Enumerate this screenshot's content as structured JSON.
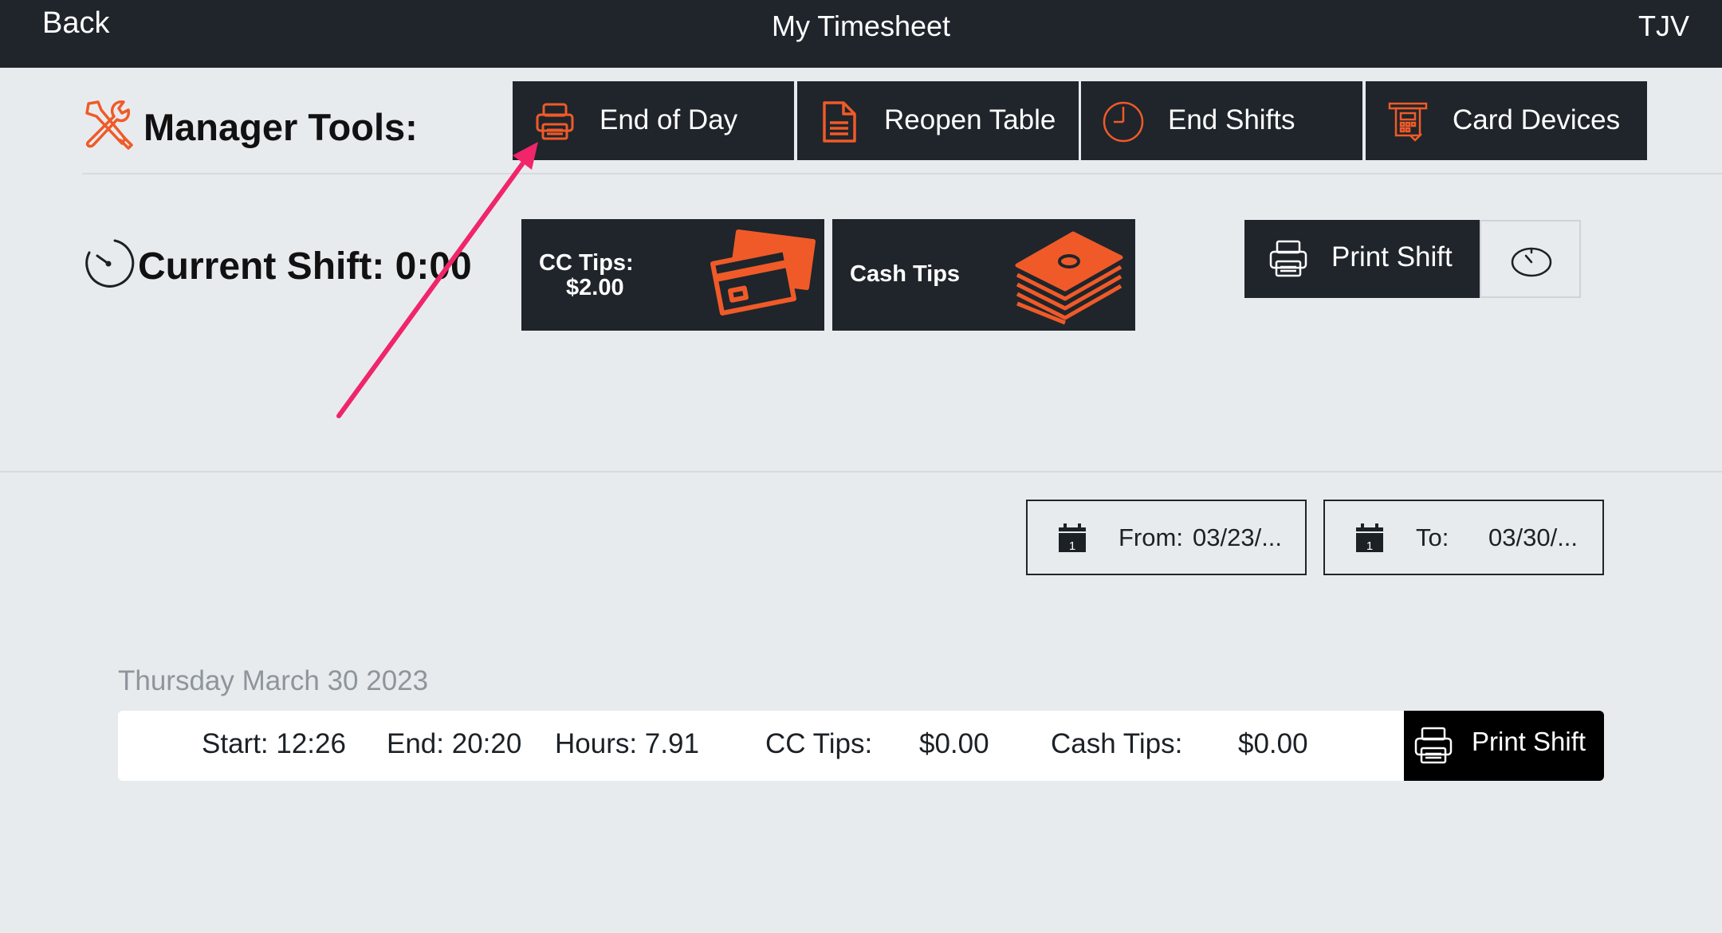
{
  "header": {
    "back_label": "Back",
    "title": "My Timesheet",
    "user_initials": "TJV"
  },
  "manager_tools": {
    "label": "Manager Tools:",
    "buttons": [
      {
        "label": "End of Day",
        "icon": "printer-icon"
      },
      {
        "label": "Reopen Table",
        "icon": "document-icon"
      },
      {
        "label": "End Shifts",
        "icon": "clock-icon"
      },
      {
        "label": "Card Devices",
        "icon": "card-terminal-icon"
      }
    ]
  },
  "current_shift": {
    "label": "Current Shift: 0:00",
    "cc_tips_label": "CC Tips:",
    "cc_tips_value": "$2.00",
    "cash_tips_label": "Cash Tips",
    "print_shift_label": "Print Shift"
  },
  "date_range": {
    "from_label": "From:",
    "from_value": "03/23/...",
    "to_label": "To:",
    "to_value": "03/30/...",
    "calendar_day": "1"
  },
  "shifts": [
    {
      "date": "Thursday March 30 2023",
      "start": "Start: 12:26",
      "end": "End: 20:20",
      "hours": "Hours: 7.91",
      "cc_tips_label": "CC Tips:",
      "cc_tips_value": "$0.00",
      "cash_tips_label": "Cash Tips:",
      "cash_tips_value": "$0.00",
      "print_label": "Print Shift"
    }
  ],
  "colors": {
    "accent": "#f05a28",
    "dark": "#1f252b",
    "background": "#e8ebee",
    "annotation": "#f0256a"
  }
}
